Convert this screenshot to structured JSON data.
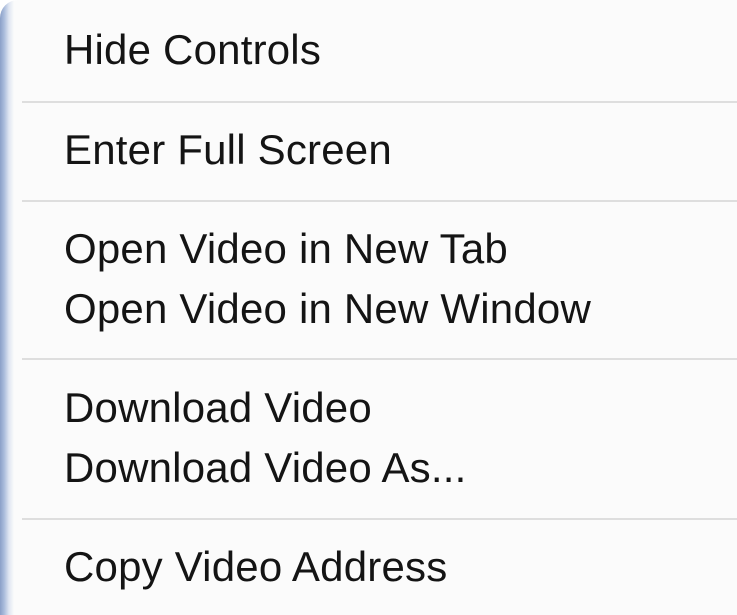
{
  "context_menu": {
    "items": [
      {
        "label": "Hide Controls"
      },
      {
        "label": "Enter Full Screen"
      },
      {
        "label": "Open Video in New Tab"
      },
      {
        "label": "Open Video in New Window"
      },
      {
        "label": "Download Video"
      },
      {
        "label": "Download Video As..."
      },
      {
        "label": "Copy Video Address"
      }
    ]
  }
}
